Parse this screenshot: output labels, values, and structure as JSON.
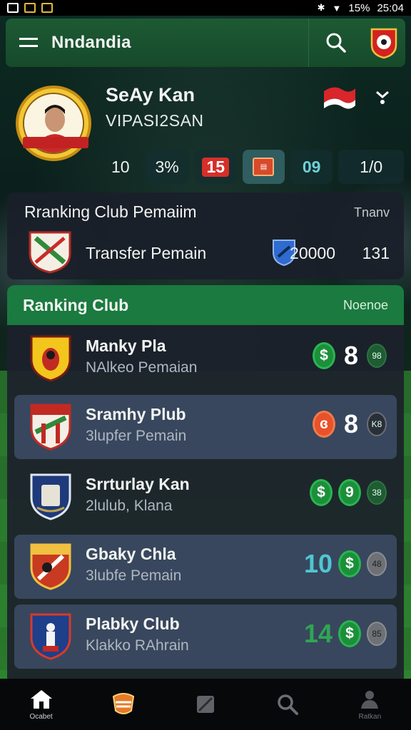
{
  "status_bar": {
    "battery": "15%",
    "time": "25:04"
  },
  "header": {
    "title": "Nndandia"
  },
  "profile": {
    "name": "SeAy Kan",
    "subtitle": "VIPASI2SAN",
    "stats": [
      "10",
      "3%",
      "15",
      "09",
      "1/0"
    ]
  },
  "transfer_card": {
    "title": "Rranking Club Pemaiim",
    "action": "Tnanv",
    "label": "Transfer Pemain",
    "value": "20000",
    "count": "131"
  },
  "ranking": {
    "title": "Ranking Club",
    "action": "Noenoe",
    "clubs": [
      {
        "name": "Manky Pla",
        "sub": "NAlkeo Pemaian",
        "num": "8",
        "mini": "98"
      },
      {
        "name": "Sramhy Plub",
        "sub": "3lupfer Pemain",
        "num": "8",
        "mini": "K8"
      },
      {
        "name": "Srrturlay Kan",
        "sub": "2lulub, Klana",
        "num": "9",
        "mini": "38"
      },
      {
        "name": "Gbaky Chla",
        "sub": "3lubfe Pemain",
        "num": "10",
        "mini": "48"
      },
      {
        "name": "Plabky Club",
        "sub": "Klakko RAhrain",
        "num": "14",
        "mini": "85"
      }
    ]
  },
  "nav": {
    "home_label": "Ocabet",
    "profile_label": "Ratkan"
  },
  "colors": {
    "accent_green": "#1b7a3f",
    "coin_green": "#1c8f3b",
    "alert_red": "#d62f2a"
  }
}
